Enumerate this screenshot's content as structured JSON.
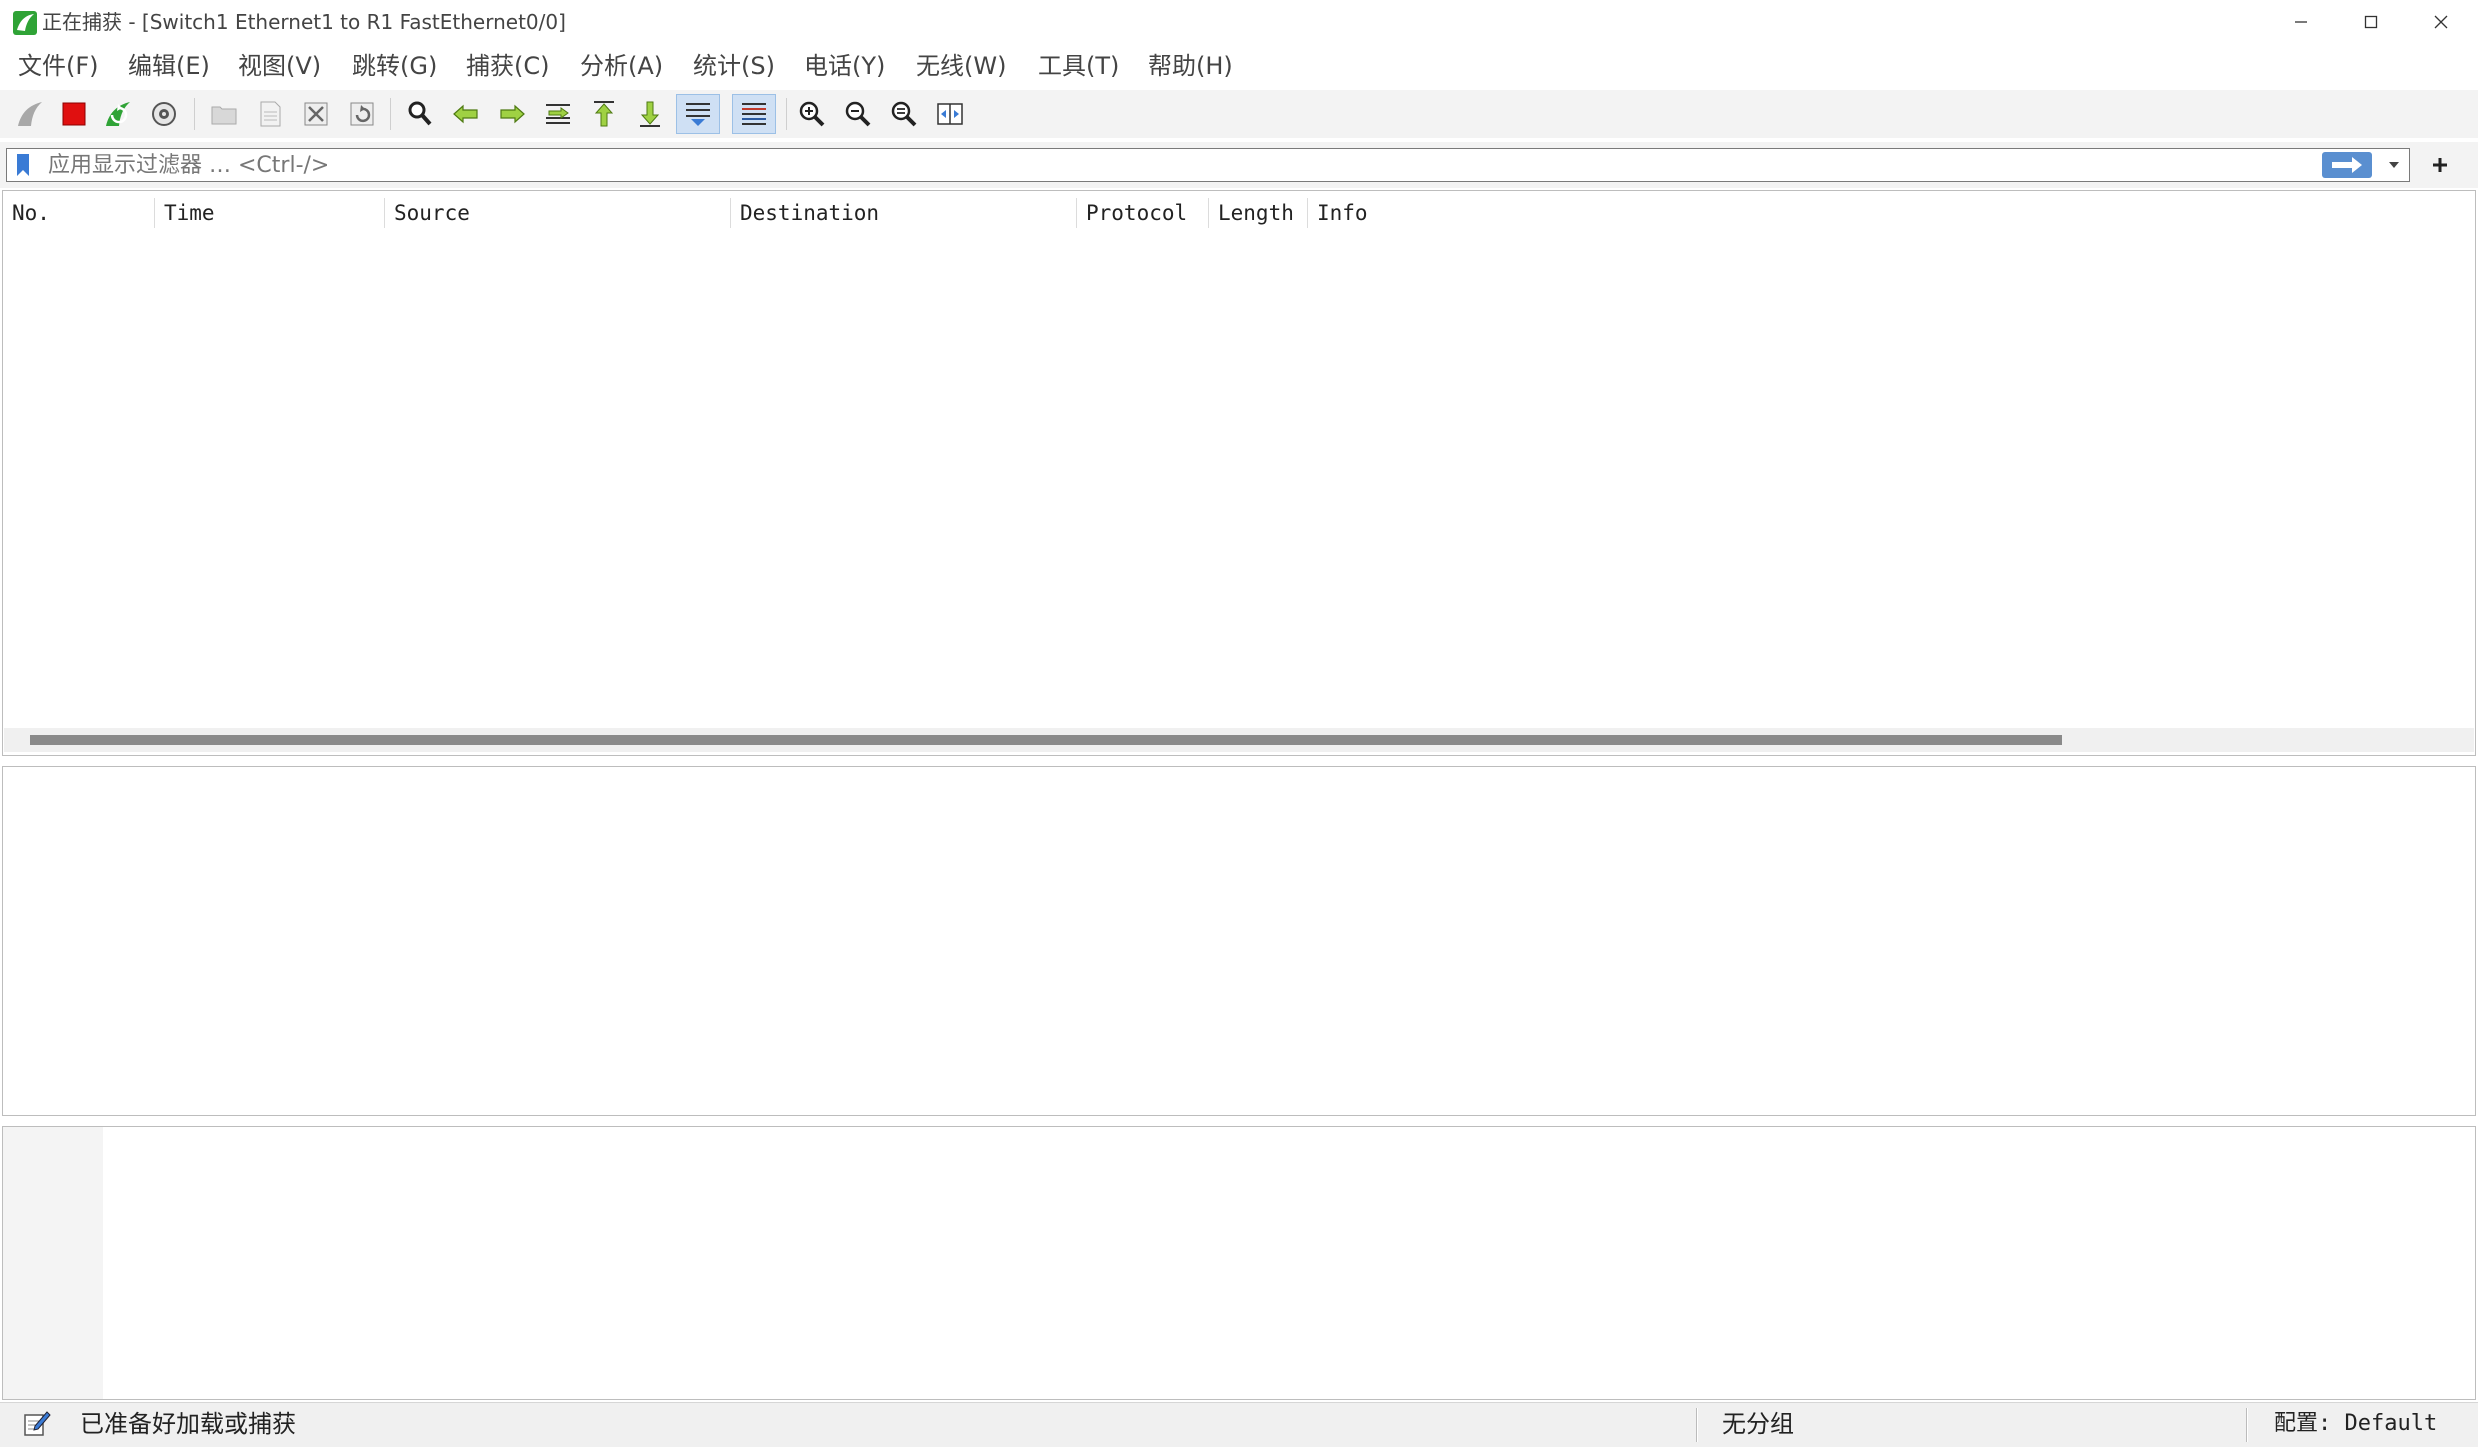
{
  "window": {
    "title": "正在捕获 - [Switch1 Ethernet1 to R1 FastEthernet0/0]"
  },
  "menu": [
    "文件(F)",
    "编辑(E)",
    "视图(V)",
    "跳转(G)",
    "捕获(C)",
    "分析(A)",
    "统计(S)",
    "电话(Y)",
    "无线(W)",
    "工具(T)",
    "帮助(H)"
  ],
  "toolbar": {
    "icons": [
      "shark-fin-start-icon",
      "stop-capture-icon",
      "restart-capture-icon",
      "capture-options-icon",
      "open-file-icon",
      "save-file-icon",
      "close-file-icon",
      "reload-file-icon",
      "find-packet-icon",
      "go-back-icon",
      "go-forward-icon",
      "go-to-packet-icon",
      "first-packet-icon",
      "last-packet-icon",
      "auto-scroll-icon",
      "colorize-icon",
      "zoom-in-icon",
      "zoom-out-icon",
      "normal-size-icon",
      "resize-columns-icon"
    ],
    "active": [
      "auto-scroll-icon",
      "colorize-icon"
    ]
  },
  "filter": {
    "value": "",
    "placeholder": "应用显示过滤器 … <Ctrl-/>"
  },
  "packet_list": {
    "columns": [
      "No.",
      "Time",
      "Source",
      "Destination",
      "Protocol",
      "Length",
      "Info"
    ],
    "rows": []
  },
  "status": {
    "ready_text": "已准备好加载或捕获",
    "packets_text": "无分组",
    "profile_text": "配置: Default"
  },
  "colors": {
    "accent": "#5a8fd0",
    "stop_red": "#e01010",
    "shark_green": "#2fa336"
  }
}
